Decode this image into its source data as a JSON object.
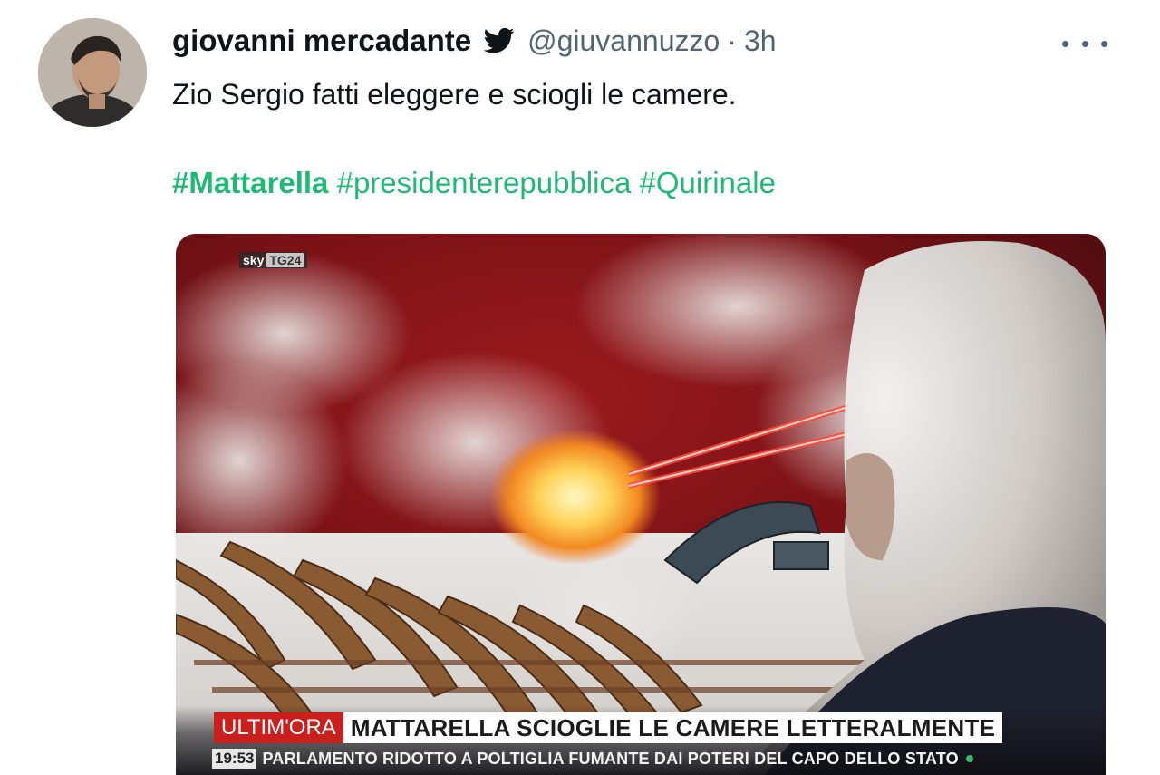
{
  "tweet": {
    "author_name": "giovanni mercadante",
    "handle": "@giuvannuzzo",
    "separator": "·",
    "time": "3h",
    "text": "Zio Sergio fatti eleggere e sciogli le camere.",
    "hashtags": [
      "#Mattarella",
      "#presidenterepubblica",
      "#Quirinale"
    ],
    "icons": {
      "platform": "twitter-bird-icon",
      "more": "more-options-icon"
    },
    "colors": {
      "hashtag": "#1dba74",
      "secondary_text": "#536471",
      "primary_text": "#0f1419"
    }
  },
  "media": {
    "logo_sky": "sky",
    "logo_tg": "TG24",
    "ticker_tag": "ULTIM'ORA",
    "ticker_headline": "MATTARELLA SCIOGLIE LE CAMERE LETTERALMENTE",
    "ticker_time": "19:53",
    "ticker_sub": "PARLAMENTO RIDOTTO A POLTIGLIA FUMANTE DAI POTERI DEL CAPO DELLO STATO",
    "colors": {
      "ticker_tag_bg": "#c9201e",
      "status_dot": "#3bb86a"
    }
  }
}
